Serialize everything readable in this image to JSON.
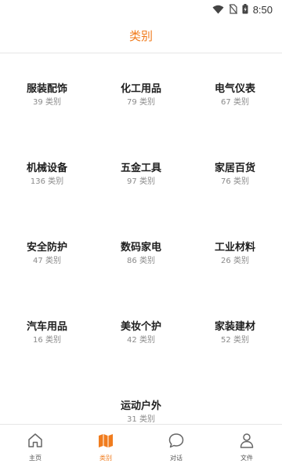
{
  "status_bar": {
    "time": "8:50"
  },
  "header": {
    "title": "类别"
  },
  "categories": [
    {
      "name": "服装配饰",
      "count": "39 类别"
    },
    {
      "name": "化工用品",
      "count": "79 类别"
    },
    {
      "name": "电气仪表",
      "count": "67 类别"
    },
    {
      "name": "机械设备",
      "count": "136 类别"
    },
    {
      "name": "五金工具",
      "count": "97 类别"
    },
    {
      "name": "家居百货",
      "count": "76 类别"
    },
    {
      "name": "安全防护",
      "count": "47 类别"
    },
    {
      "name": "数码家电",
      "count": "86 类别"
    },
    {
      "name": "工业材料",
      "count": "26 类别"
    },
    {
      "name": "汽车用品",
      "count": "16 类别"
    },
    {
      "name": "美妆个护",
      "count": "42 类别"
    },
    {
      "name": "家装建材",
      "count": "52 类别"
    },
    {
      "name": "运动户外",
      "count": "31 类别"
    }
  ],
  "tab_bar": {
    "active_color": "#f07c1e",
    "tabs": [
      {
        "label": "主页",
        "icon": "home-icon",
        "active": false
      },
      {
        "label": "类别",
        "icon": "map-icon",
        "active": true
      },
      {
        "label": "对话",
        "icon": "chat-icon",
        "active": false
      },
      {
        "label": "文件",
        "icon": "user-icon",
        "active": false
      }
    ]
  }
}
